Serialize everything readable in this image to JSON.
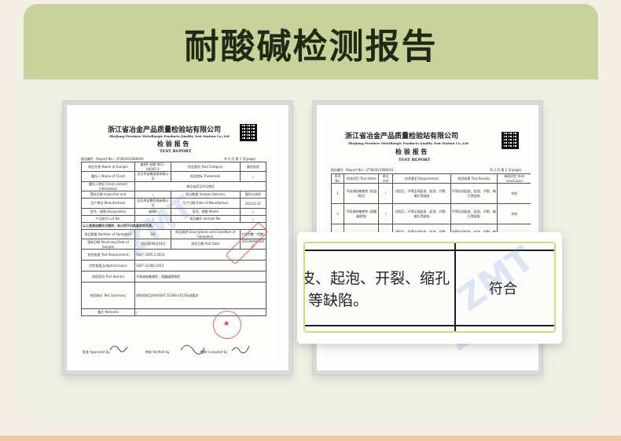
{
  "header": {
    "title": "耐酸碱检测报告"
  },
  "report_left": {
    "org_cn": "浙江省冶金产品质量检验站有限公司",
    "org_en": "Zhejiang Province Metallurgic Products Quality Test Station Co.,Ltd",
    "doc_cn": "检 验 报 告",
    "doc_en": "TEST REPORT",
    "report_no": "报告编号（Report No.）ZYW2023080041",
    "page": "共 2 页 第 1 页(page)",
    "rows": [
      [
        "样品名称 Name of Sample",
        "盛帆K 低裂 WCC-A0005-1",
        "检验类别 Test Category",
        "委托检验"
      ],
      [
        "委托人 Name of Client",
        "武汉市自尊家具有限公司",
        "样品商标 Trademark",
        "/"
      ],
      [
        "委托人地址 Client contact information",
        "湖北省武汉市汉南区",
        "",
        ""
      ],
      [
        "受检日期 Inspected unit",
        "/",
        "样品数量 Sample Delivery",
        "委托方送样"
      ],
      [
        "生产单位 Manufacturer",
        "武汉市自尊家具有限公司",
        "生产日期 Date of Manufacture",
        "2023.6.31"
      ],
      [
        "型号、规格 Designation",
        "盛帆K",
        "型号、规格 Model",
        "/"
      ],
      [
        "产品批号 Lot No.",
        "/",
        "样品编号 Sample No.",
        "/"
      ]
    ],
    "notice": "以上信息由委托方提供，本公司不对其真实性负责。",
    "rows2": [
      [
        "样品数量 Number of Sample(s)",
        "2件",
        "样品描述 Descriptions and Condition of Sample(s)",
        "产品完整（完整）"
      ],
      [
        "接样日期 Receiving Date of Sample",
        "2023年08月04日",
        "检验日期 Test Date",
        "2023年08月04日"
      ],
      [
        "检验依据 Test Requirement",
        "QB/T 3205.2-2013",
        "",
        ""
      ],
      [
        "判定依据 Judgment basis",
        "GB/T 32366-2015",
        "",
        ""
      ],
      [
        "检验项目 Test Item(s)",
        "不耐液贴敏感性，耐酸碱腐蚀性",
        "",
        ""
      ],
      [
        "检验结论 Test Summary",
        "经检验样品符合GB/T 32366-2015标准要求",
        "",
        ""
      ],
      [
        "备注 Remarks",
        "/",
        "",
        ""
      ]
    ],
    "sign_approved": "批准 Approved by",
    "sign_verified": "审核 Verified by",
    "sign_compiled": "编制 Compiled by"
  },
  "report_right": {
    "org_cn": "浙江省冶金产品质量检验站有限公司",
    "org_en": "Zhejiang Province Metallurgic Products Quality Test Station Co.,Ltd",
    "doc_cn": "检 验 报 告",
    "doc_en": "TEST REPORT",
    "report_no": "报告编号（Report No.）ZYW2023080041",
    "page": "共 2 页 第 2 页(page)",
    "headers": [
      "序号 No.",
      "检验项目 Test Items",
      "单位 Unit",
      "技术要求 Requirement",
      "检验结果 Test Results",
      "单项评定 Item conclusion"
    ],
    "rows": [
      [
        "1",
        "不耐液贴敏感性 (耐温测试)",
        "/",
        "试验后，不得出现起皮、起泡、开裂、缩孔等缺陷",
        "不得出现起皮、起泡、开裂、缩孔等缺陷",
        "符合"
      ],
      [
        "2",
        "不耐液贴敏感性 (耐酸碱腐蚀)",
        "/",
        "试验后，不得出现起皮、起泡、开裂、缩孔等缺陷",
        "不得出现起皮、起泡、开裂、缩孔等缺陷",
        "符合"
      ],
      [
        "3",
        "不耐液贴敏感性",
        "/",
        "试验后，不得出现起皮、起泡、开裂、缩孔等缺陷",
        "不得出现起皮、起泡、开裂、缩孔等缺陷",
        "符合"
      ]
    ]
  },
  "zoom": {
    "line1": "皮、起泡、开裂、缩孔",
    "line2": "等缺陷。",
    "result": "符合"
  },
  "watermark": "ZMT"
}
